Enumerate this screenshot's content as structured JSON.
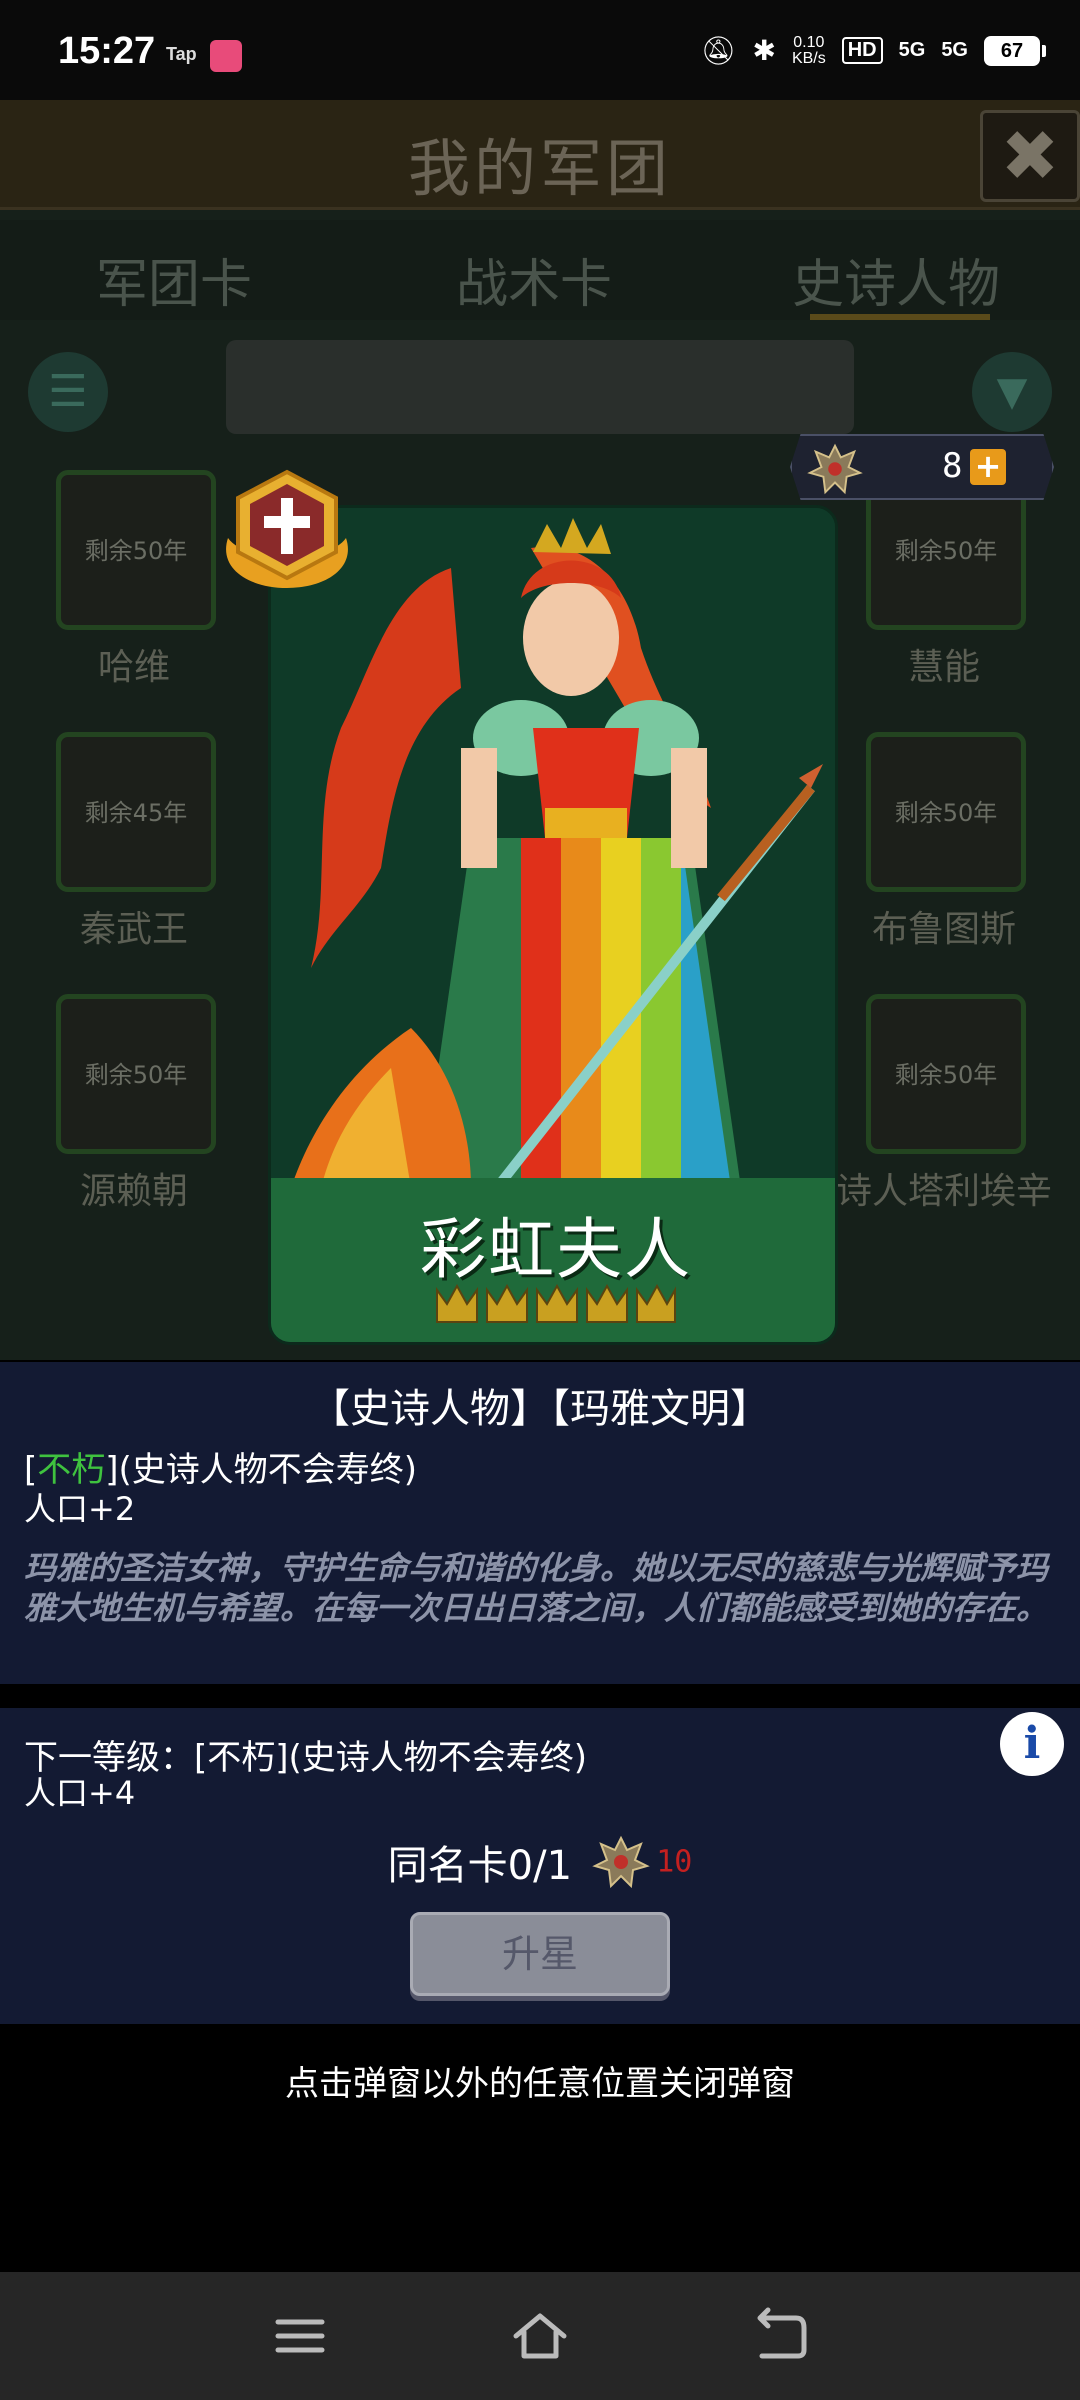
{
  "status_bar": {
    "time": "15:27",
    "app_label": "Tap",
    "net_speed_value": "0.10",
    "net_speed_unit": "KB/s",
    "hd_label": "HD",
    "signal1": "5G",
    "signal2": "5G",
    "battery": "67"
  },
  "game": {
    "title": "我的军团",
    "tabs": [
      "军团卡",
      "战术卡",
      "史诗人物"
    ],
    "grid": [
      {
        "time": "剩余50年",
        "name": "哈维"
      },
      {
        "time": "剩余50年",
        "name": "慧能"
      },
      {
        "time": "剩余45年",
        "name": "秦武王"
      },
      {
        "time": "剩余50年",
        "name": "布鲁图斯"
      },
      {
        "time": "剩余50年",
        "name": "源赖朝"
      },
      {
        "time": "剩余50年",
        "name": "诗人塔利埃辛"
      }
    ],
    "currency": {
      "value": "8",
      "add_icon": "plus-icon"
    }
  },
  "card": {
    "name": "彩虹夫人",
    "stars": 5,
    "colors": {
      "banner": "#1f6a3a",
      "crown": "#c9a020"
    }
  },
  "info": {
    "title": "【史诗人物】【玛雅文明】",
    "trait_open": "[",
    "trait_name": "不朽",
    "trait_rest": "](史诗人物不会寿终)",
    "population": "人口+2",
    "description": "玛雅的圣洁女神，守护生命与和谐的化身。她以无尽的慈悲与光辉赋予玛雅大地生机与希望。在每一次日出日落之间，人们都能感受到她的存在。"
  },
  "next_level": {
    "line": "下一等级：[不朽](史诗人物不会寿终)",
    "population": "人口+4",
    "duplicate_label": "同名卡0/1",
    "duplicate_cost": "10",
    "upgrade_label": "升星"
  },
  "close_hint": "点击弹窗以外的任意位置关闭弹窗",
  "nav": {
    "icons": [
      "menu-icon",
      "home-icon",
      "back-icon"
    ]
  }
}
